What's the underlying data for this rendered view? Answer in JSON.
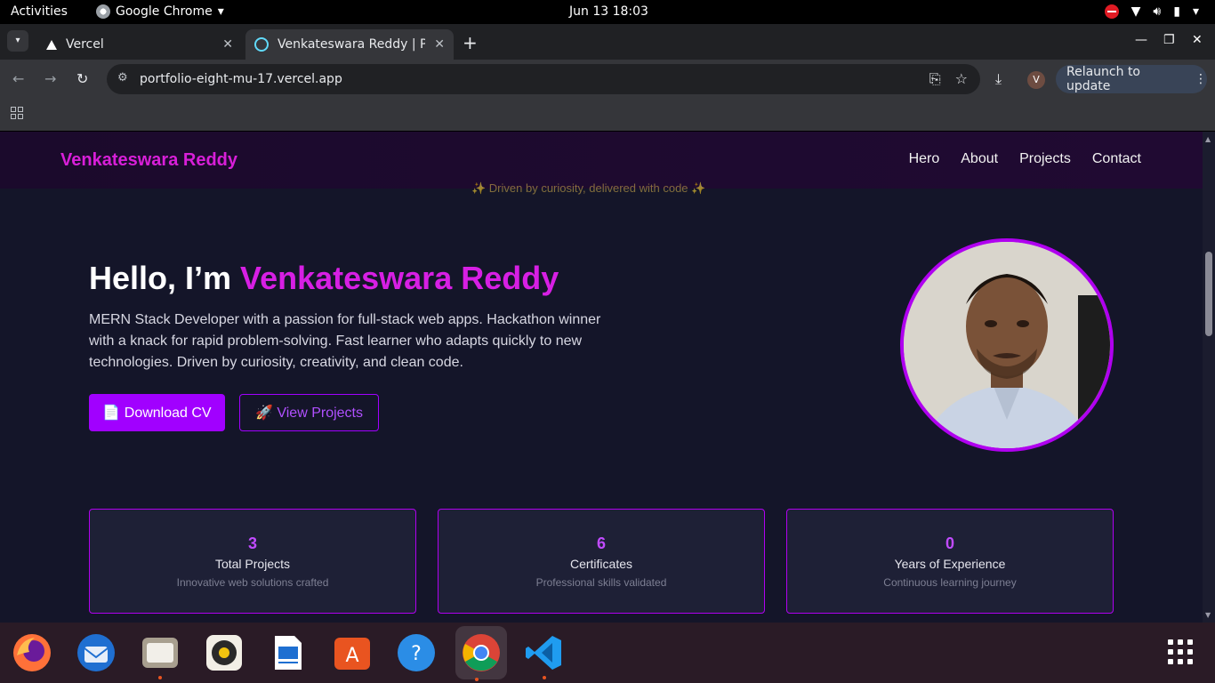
{
  "system": {
    "activities": "Activities",
    "app_name": "Google Chrome",
    "clock": "Jun 13  18:03"
  },
  "browser": {
    "tabs": [
      {
        "title": "Vercel",
        "icon": "vercel-icon"
      },
      {
        "title": "Venkateswara Reddy | P",
        "icon": "react-icon"
      }
    ],
    "url": "portfolio-eight-mu-17.vercel.app",
    "profile_initial": "V",
    "relaunch_label": "Relaunch to update"
  },
  "site": {
    "brand": "Venkateswara Reddy",
    "nav": [
      "Hero",
      "About",
      "Projects",
      "Contact"
    ],
    "tagline": "✨ Driven by curiosity, delivered with code ✨",
    "hero": {
      "greeting": "Hello, I’m ",
      "name": "Venkateswara Reddy",
      "description": "MERN Stack Developer with a passion for full-stack web apps. Hackathon winner with a knack for rapid problem-solving. Fast learner who adapts quickly to new technologies. Driven by curiosity, creativity, and clean code.",
      "cv_button": "📄 Download CV",
      "projects_button": "🚀 View Projects"
    },
    "stats": [
      {
        "value": "3",
        "label": "Total Projects",
        "sub": "Innovative web solutions crafted"
      },
      {
        "value": "6",
        "label": "Certificates",
        "sub": "Professional skills validated"
      },
      {
        "value": "0",
        "label": "Years of Experience",
        "sub": "Continuous learning journey"
      }
    ]
  },
  "dock": [
    "firefox-icon",
    "thunderbird-icon",
    "files-icon",
    "rhythmbox-icon",
    "writer-icon",
    "app-center-icon",
    "help-icon",
    "chrome-icon",
    "vscode-icon"
  ],
  "colors": {
    "accent": "#a100ff",
    "brand": "#d81fd8",
    "background": "#141529"
  }
}
